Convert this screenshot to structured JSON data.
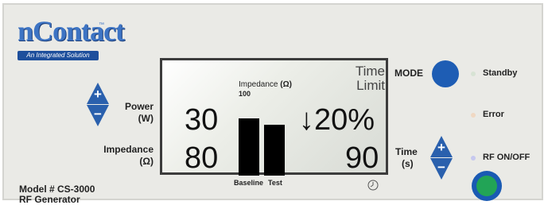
{
  "logo": {
    "brand": "nContact",
    "tagline": "An Integrated Solution",
    "tm": "™"
  },
  "power": {
    "label_line1": "Power",
    "label_line2": "(W)",
    "plus": "+",
    "minus": "−"
  },
  "impedance": {
    "label_line1": "Impedance",
    "label_line2": "(Ω)"
  },
  "model": {
    "line1": "Model # CS-3000",
    "line2": "RF Generator"
  },
  "display": {
    "power_value": "30",
    "impedance_value": "80",
    "impedance_header": "Impedance",
    "impedance_unit": "(Ω)",
    "impedance_scale": "100",
    "impedance_drop": "↓20%",
    "time_limit_line1": "Time",
    "time_limit_line2": "Limit",
    "time_value": "90",
    "baseline_label": "Baseline",
    "test_label": "Test",
    "baseline_fraction": 0.72,
    "test_fraction": 0.64,
    "clock_icon": "clock-icon"
  },
  "mode": {
    "label": "MODE"
  },
  "time": {
    "label_line1": "Time",
    "label_line2": "(s)",
    "plus": "+",
    "minus": "−"
  },
  "status": {
    "standby_label": "Standby",
    "error_label": "Error",
    "rf_label": "RF ON/OFF",
    "standby_color": "#d7e3d4",
    "error_color": "#f0d8c2",
    "rf_led_color": "#c6c8ef"
  },
  "colors": {
    "accent_blue": "#2a60ad",
    "rf_green": "#22a456"
  }
}
